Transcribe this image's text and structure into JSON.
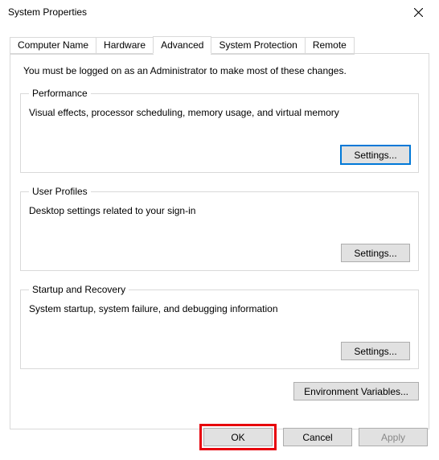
{
  "window": {
    "title": "System Properties"
  },
  "tabs": {
    "computer_name": "Computer Name",
    "hardware": "Hardware",
    "advanced": "Advanced",
    "system_protection": "System Protection",
    "remote": "Remote"
  },
  "intro": "You must be logged on as an Administrator to make most of these changes.",
  "groups": {
    "performance": {
      "legend": "Performance",
      "desc": "Visual effects, processor scheduling, memory usage, and virtual memory",
      "button": "Settings..."
    },
    "user_profiles": {
      "legend": "User Profiles",
      "desc": "Desktop settings related to your sign-in",
      "button": "Settings..."
    },
    "startup_recovery": {
      "legend": "Startup and Recovery",
      "desc": "System startup, system failure, and debugging information",
      "button": "Settings..."
    }
  },
  "env_button": "Environment Variables...",
  "footer": {
    "ok": "OK",
    "cancel": "Cancel",
    "apply": "Apply"
  }
}
